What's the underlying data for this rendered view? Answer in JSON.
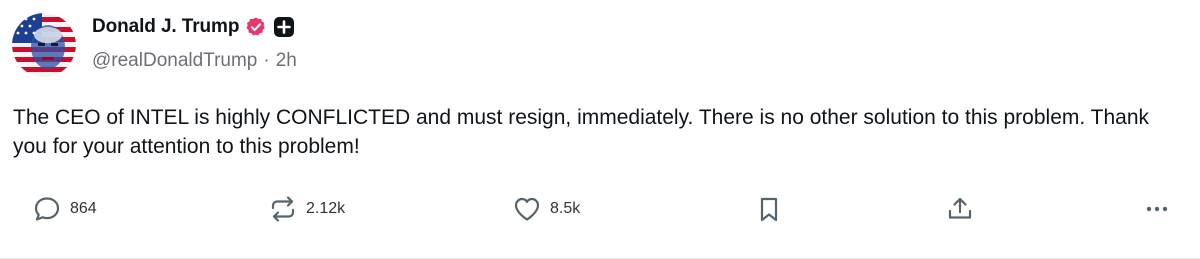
{
  "author": {
    "display_name": "Donald J. Trump",
    "handle": "@realDonaldTrump",
    "separator": "·",
    "time_ago": "2h",
    "avatar_icon": "american-flag-portrait-avatar",
    "verified_icon": "verified-badge-icon",
    "badge_icon": "plus-badge-icon"
  },
  "post": {
    "text": "The CEO of INTEL is highly CONFLICTED and must resign, immediately. There is no other solution to this problem. Thank you for your attention to this problem!"
  },
  "actions": {
    "reply_count": "864",
    "repost_count": "2.12k",
    "like_count": "8.5k"
  },
  "colors": {
    "verified": "#e8366a",
    "icon_gray": "#536471",
    "handle_gray": "#6b6f76",
    "text": "#0f1419"
  }
}
